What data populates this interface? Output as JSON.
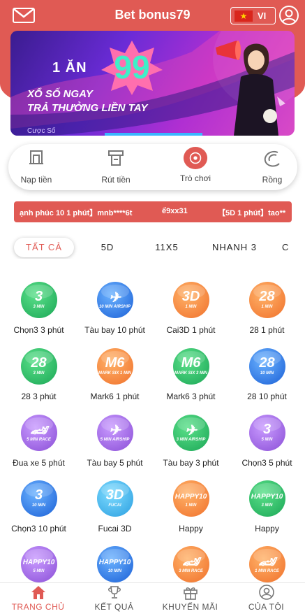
{
  "header": {
    "title": "Bet bonus79",
    "language": "VI",
    "mail_icon": "mail-icon",
    "user_icon": "user-icon"
  },
  "banner": {
    "line1": "1 ĂN",
    "big_number": "99",
    "line2": "XỔ SỐ NGAY",
    "line3": "TRẢ THƯỞNG LIỀN TAY",
    "caption": "Cược Số"
  },
  "quick_menu": [
    {
      "label": "Nạp tiền",
      "icon": "deposit-icon"
    },
    {
      "label": "Rút tiền",
      "icon": "withdraw-icon"
    },
    {
      "label": "Trò chơi",
      "icon": "games-icon"
    },
    {
      "label": "Rồng",
      "icon": "dragon-icon"
    }
  ],
  "marquee": [
    "ạnh phúc 10 1 phút】mnb****6t",
    "ể9xx31",
    "【5D 1 phút】tao**"
  ],
  "tabs": [
    "TẤT CẢ",
    "5D",
    "11X5",
    "NHANH 3",
    "C"
  ],
  "games": [
    {
      "label": "Chọn3 3 phút",
      "icon": "pick3-icon",
      "badge": "3",
      "sub": "3 MIN"
    },
    {
      "label": "Tàu bay 10 phút",
      "icon": "airship-icon",
      "badge": "✈",
      "sub": "10 MIN AIRSHIP"
    },
    {
      "label": "Cai3D 1 phút",
      "icon": "cai3d-icon",
      "badge": "3D",
      "sub": "1 MIN"
    },
    {
      "label": "28 1 phút",
      "icon": "lotto28-icon",
      "badge": "28",
      "sub": "1 MIN"
    },
    {
      "label": "28 3 phút",
      "icon": "lotto28-icon",
      "badge": "28",
      "sub": "3 MIN"
    },
    {
      "label": "Mark6 1 phút",
      "icon": "mark6-icon",
      "badge": "M6",
      "sub": "MARK SIX 1 MIN"
    },
    {
      "label": "Mark6 3 phút",
      "icon": "mark6-icon",
      "badge": "M6",
      "sub": "MARK SIX 3 MIN"
    },
    {
      "label": "28 10 phút",
      "icon": "lotto28-icon",
      "badge": "28",
      "sub": "10 MIN"
    },
    {
      "label": "Đua xe 5 phút",
      "icon": "race-icon",
      "badge": "🏎",
      "sub": "5 MIN RACE"
    },
    {
      "label": "Tàu bay 5 phút",
      "icon": "airship-icon",
      "badge": "✈",
      "sub": "5 MIN AIRSHIP"
    },
    {
      "label": "Tàu bay 3 phút",
      "icon": "airship-icon",
      "badge": "✈",
      "sub": "3 MIN AIRSHIP"
    },
    {
      "label": "Chọn3 5 phút",
      "icon": "pick3-icon",
      "badge": "3",
      "sub": "5 MIN"
    },
    {
      "label": "Chọn3 10 phút",
      "icon": "pick3-icon",
      "badge": "3",
      "sub": "10 MIN"
    },
    {
      "label": "Fucai 3D",
      "icon": "fucai-icon",
      "badge": "3D",
      "sub": "FUCAI"
    },
    {
      "label": "Happy",
      "icon": "happy10-icon",
      "badge": "HAPPY10",
      "sub": "1 MIN"
    },
    {
      "label": "Happy",
      "icon": "happy10-icon",
      "badge": "HAPPY10",
      "sub": "3 MIN"
    },
    {
      "label": "",
      "icon": "happy10-icon",
      "badge": "HAPPY10",
      "sub": "5 MIN"
    },
    {
      "label": "",
      "icon": "happy10-icon",
      "badge": "HAPPY10",
      "sub": "10 MIN"
    },
    {
      "label": "",
      "icon": "race-icon",
      "badge": "🏎",
      "sub": "3 MIN RACE"
    },
    {
      "label": "",
      "icon": "race-icon",
      "badge": "🏎",
      "sub": "1 MIN RACE"
    }
  ],
  "bottom_nav": [
    {
      "label": "TRANG CHỦ",
      "icon": "home-icon",
      "active": true
    },
    {
      "label": "KẾT QUẢ",
      "icon": "trophy-icon",
      "active": false
    },
    {
      "label": "KHUYẾN MÃI",
      "icon": "gift-icon",
      "active": false
    },
    {
      "label": "CỦA TÔI",
      "icon": "user-icon",
      "active": false
    }
  ],
  "colors": {
    "accent": "#e05a54",
    "green": "#1aa655",
    "blue": "#1a5fd6",
    "orange": "#f0702a",
    "purple": "#8a4ed6"
  }
}
